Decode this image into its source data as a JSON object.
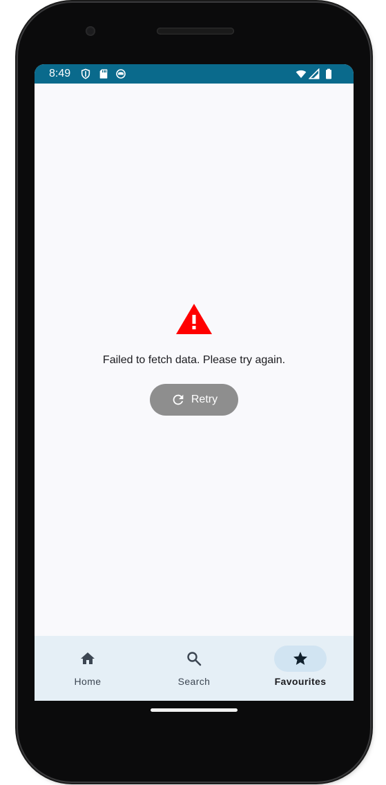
{
  "status_bar": {
    "time": "8:49",
    "left_icons": [
      "shield-icon",
      "sd-card-icon",
      "app-notification-icon"
    ],
    "right_icons": [
      "wifi-icon",
      "signal-icon",
      "battery-icon"
    ],
    "color": "#0a6a8c"
  },
  "error": {
    "icon": "warning-icon",
    "icon_color": "#ff0000",
    "message": "Failed to fetch data. Please try again."
  },
  "retry_button": {
    "icon": "refresh-icon",
    "label": "Retry",
    "color": "#8e8e8e"
  },
  "bottom_nav": {
    "items": [
      {
        "label": "Home",
        "icon": "home-icon",
        "selected": false
      },
      {
        "label": "Search",
        "icon": "search-icon",
        "selected": false
      },
      {
        "label": "Favourites",
        "icon": "star-icon",
        "selected": true
      }
    ],
    "background": "#e5eff6",
    "selected_pill": "#d1e4f2"
  }
}
